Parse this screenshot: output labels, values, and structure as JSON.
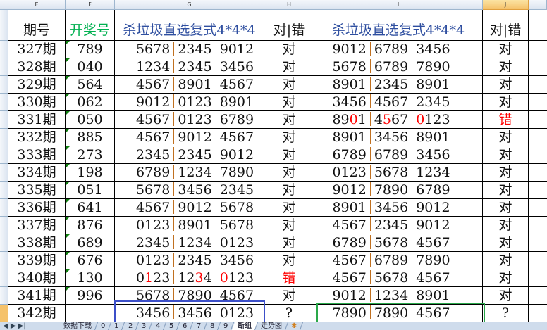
{
  "columns": [
    "E",
    "F",
    "G",
    "H",
    "I",
    "J"
  ],
  "headers": {
    "period": "期号",
    "draw": "开奖号",
    "kill_g": "杀垃圾直选复式4*4*4",
    "result_h": "对|错",
    "kill_i": "杀垃圾直选复式4*4*4",
    "result_j": "对|错"
  },
  "rows": [
    {
      "period": "327期",
      "draw": "789",
      "g": [
        "5678",
        "2345",
        "9012"
      ],
      "gred": [
        [],
        [],
        []
      ],
      "h": "对",
      "i": [
        "9012",
        "6789",
        "3456"
      ],
      "ired": [
        [],
        [],
        []
      ],
      "j": "对"
    },
    {
      "period": "328期",
      "draw": "040",
      "g": [
        "1234",
        "2345",
        "3456"
      ],
      "gred": [
        [],
        [],
        []
      ],
      "h": "对",
      "i": [
        "5678",
        "6789",
        "7890"
      ],
      "ired": [
        [],
        [],
        []
      ],
      "j": "对"
    },
    {
      "period": "329期",
      "draw": "564",
      "g": [
        "4567",
        "8901",
        "4567"
      ],
      "gred": [
        [],
        [],
        []
      ],
      "h": "对",
      "i": [
        "8901",
        "2345",
        "8901"
      ],
      "ired": [
        [],
        [],
        []
      ],
      "j": "对"
    },
    {
      "period": "330期",
      "draw": "062",
      "g": [
        "9012",
        "0123",
        "8901"
      ],
      "gred": [
        [],
        [],
        []
      ],
      "h": "对",
      "i": [
        "3456",
        "4567",
        "2345"
      ],
      "ired": [
        [],
        [],
        []
      ],
      "j": "对"
    },
    {
      "period": "331期",
      "draw": "050",
      "g": [
        "4567",
        "0123",
        "6789"
      ],
      "gred": [
        [],
        [],
        []
      ],
      "h": "对",
      "i": [
        "8901",
        "4567",
        "0123"
      ],
      "ired": [
        [
          2
        ],
        [
          1
        ],
        [
          0
        ]
      ],
      "j": "错",
      "jred": true
    },
    {
      "period": "332期",
      "draw": "885",
      "g": [
        "4567",
        "9012",
        "4567"
      ],
      "gred": [
        [],
        [],
        []
      ],
      "h": "对",
      "i": [
        "8901",
        "3456",
        "8901"
      ],
      "ired": [
        [],
        [],
        []
      ],
      "j": "对"
    },
    {
      "period": "333期",
      "draw": "273",
      "g": [
        "2345",
        "2345",
        "9012"
      ],
      "gred": [
        [],
        [],
        []
      ],
      "h": "对",
      "i": [
        "6789",
        "6789",
        "3456"
      ],
      "ired": [
        [],
        [],
        []
      ],
      "j": "对"
    },
    {
      "period": "334期",
      "draw": "198",
      "g": [
        "6789",
        "1234",
        "7890"
      ],
      "gred": [
        [],
        [],
        []
      ],
      "h": "对",
      "i": [
        "0123",
        "5678",
        "1234"
      ],
      "ired": [
        [],
        [],
        []
      ],
      "j": "对"
    },
    {
      "period": "335期",
      "draw": "051",
      "g": [
        "5678",
        "3456",
        "2345"
      ],
      "gred": [
        [],
        [],
        []
      ],
      "h": "对",
      "i": [
        "9012",
        "7890",
        "6789"
      ],
      "ired": [
        [],
        [],
        []
      ],
      "j": "对"
    },
    {
      "period": "336期",
      "draw": "641",
      "g": [
        "4567",
        "9012",
        "5678"
      ],
      "gred": [
        [],
        [],
        []
      ],
      "h": "对",
      "i": [
        "8901",
        "3456",
        "9012"
      ],
      "ired": [
        [],
        [],
        []
      ],
      "j": "对"
    },
    {
      "period": "337期",
      "draw": "876",
      "g": [
        "0123",
        "8901",
        "5678"
      ],
      "gred": [
        [],
        [],
        []
      ],
      "h": "对",
      "i": [
        "4567",
        "2345",
        "9012"
      ],
      "ired": [
        [],
        [],
        []
      ],
      "j": "对"
    },
    {
      "period": "338期",
      "draw": "689",
      "g": [
        "2345",
        "1234",
        "0123"
      ],
      "gred": [
        [],
        [],
        []
      ],
      "h": "对",
      "i": [
        "6789",
        "5678",
        "4567"
      ],
      "ired": [
        [],
        [],
        []
      ],
      "j": "对"
    },
    {
      "period": "339期",
      "draw": "676",
      "g": [
        "0123",
        "2345",
        "3456"
      ],
      "gred": [
        [],
        [],
        []
      ],
      "h": "对",
      "i": [
        "4567",
        "6789",
        "7890"
      ],
      "ired": [
        [],
        [],
        []
      ],
      "j": "对"
    },
    {
      "period": "340期",
      "draw": "130",
      "g": [
        "0123",
        "1234",
        "0123"
      ],
      "gred": [
        [
          1
        ],
        [
          2
        ],
        [
          0
        ]
      ],
      "h": "错",
      "hred": true,
      "i": [
        "4567",
        "5678",
        "4567"
      ],
      "ired": [
        [],
        [],
        []
      ],
      "j": "对"
    },
    {
      "period": "341期",
      "draw": "996",
      "g": [
        "5678",
        "7890",
        "4567"
      ],
      "gred": [
        [],
        [],
        []
      ],
      "h": "对",
      "i": [
        "9012",
        "1234",
        "8901"
      ],
      "ired": [
        [],
        [],
        []
      ],
      "j": "对"
    },
    {
      "period": "342期",
      "draw": "",
      "g": [
        "3456",
        "3456",
        "0123"
      ],
      "gred": [
        [],
        [],
        []
      ],
      "h": "?",
      "i": [
        "7890",
        "7890",
        "4567"
      ],
      "ired": [
        [],
        [],
        []
      ],
      "j": "?"
    }
  ],
  "tabs": [
    "数据下载",
    "0",
    "1",
    "2",
    "3",
    "4",
    "5",
    "6",
    "7",
    "8",
    "9",
    "断组",
    "走势图"
  ],
  "active_tab": "断组",
  "colors": {
    "green": "#00b050",
    "blue_box": "#3c4fc8",
    "green_box": "#2aa84a",
    "red": "#ff0000"
  }
}
